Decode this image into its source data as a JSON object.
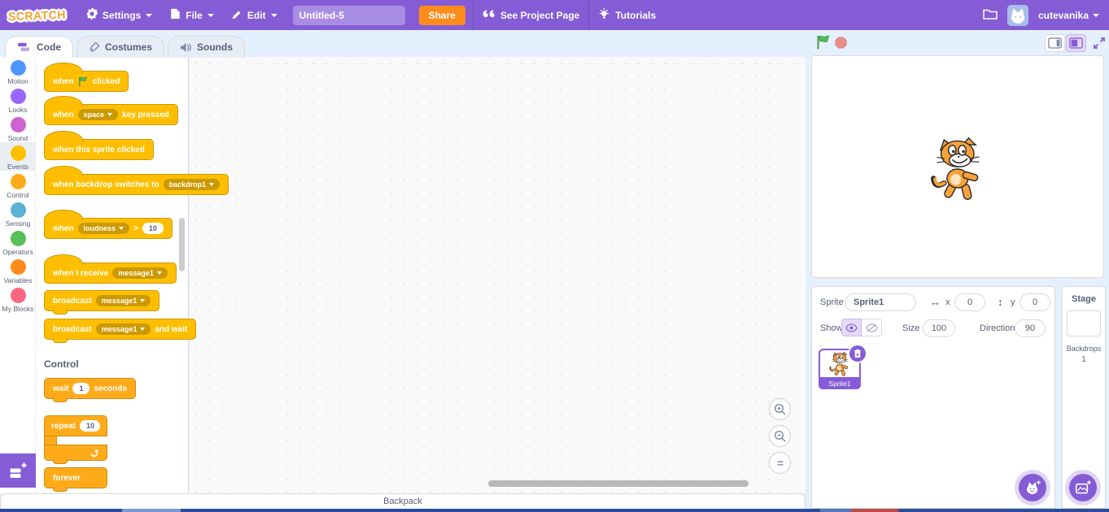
{
  "topbar": {
    "logo": "SCRATCH",
    "settings": "Settings",
    "file": "File",
    "edit": "Edit",
    "project_name": "Untitled-5",
    "share": "Share",
    "see_project_page": "See Project Page",
    "tutorials": "Tutorials",
    "username": "cutevanika"
  },
  "tabs": {
    "code": "Code",
    "costumes": "Costumes",
    "sounds": "Sounds"
  },
  "categories": [
    {
      "name": "Motion",
      "color": "#4C97FF",
      "selected": false
    },
    {
      "name": "Looks",
      "color": "#9966FF",
      "selected": false
    },
    {
      "name": "Sound",
      "color": "#CF63CF",
      "selected": false
    },
    {
      "name": "Events",
      "color": "#FFBF00",
      "selected": true
    },
    {
      "name": "Control",
      "color": "#FFAB19",
      "selected": false
    },
    {
      "name": "Sensing",
      "color": "#5CB1D6",
      "selected": false
    },
    {
      "name": "Operators",
      "color": "#59C059",
      "selected": false
    },
    {
      "name": "Variables",
      "color": "#FF8C1A",
      "selected": false
    },
    {
      "name": "My Blocks",
      "color": "#FF6680",
      "selected": false
    }
  ],
  "palette": {
    "when_flag": {
      "pre": "when",
      "post": "clicked"
    },
    "when_key": {
      "pre": "when",
      "dropdown": "space",
      "post": "key pressed"
    },
    "when_sprite": {
      "text": "when this sprite clicked"
    },
    "when_backdrop": {
      "pre": "when backdrop switches to",
      "dropdown": "backdrop1"
    },
    "when_loudness": {
      "pre": "when",
      "dropdown": "loudness",
      "op": ">",
      "value": "10"
    },
    "when_receive": {
      "pre": "when I receive",
      "dropdown": "message1"
    },
    "broadcast": {
      "pre": "broadcast",
      "dropdown": "message1"
    },
    "broadcast_wait": {
      "pre": "broadcast",
      "dropdown": "message1",
      "post": "and wait"
    },
    "control_header": "Control",
    "wait": {
      "pre": "wait",
      "value": "1",
      "post": "seconds"
    },
    "repeat": {
      "pre": "repeat",
      "value": "10"
    },
    "forever": {
      "text": "forever"
    }
  },
  "sprite_panel": {
    "sprite_label": "Sprite",
    "sprite_name": "Sprite1",
    "x_label": "x",
    "x_value": "0",
    "y_label": "y",
    "y_value": "0",
    "show_label": "Show",
    "size_label": "Size",
    "size_value": "100",
    "direction_label": "Direction",
    "direction_value": "90",
    "thumb_label": "Sprite1"
  },
  "stage_panel": {
    "title": "Stage",
    "backdrops_label": "Backdrops",
    "backdrops_count": "1"
  },
  "backpack": {
    "label": "Backpack"
  },
  "colors": {
    "topbar": "#855CD6",
    "share_button": "#FF8C1A",
    "accent": "#855CD6",
    "events_block": "#FFBF00",
    "events_dark": "#CC9900",
    "control_block": "#FFAB19",
    "control_dark": "#CF8B17",
    "page_bg": "#E5F0FF",
    "ui_text": "#575E75"
  }
}
